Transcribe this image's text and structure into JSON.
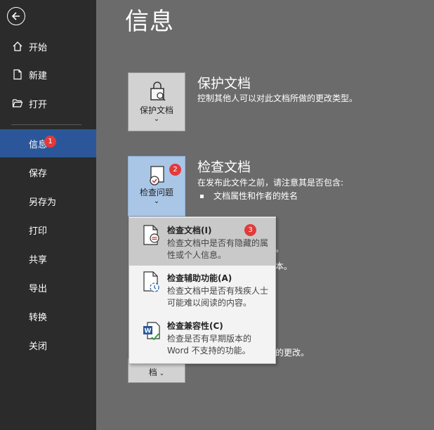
{
  "sidebar": {
    "back_icon": "arrow-left-icon",
    "items": [
      {
        "label": "开始",
        "icon": "home-icon"
      },
      {
        "label": "新建",
        "icon": "new-document-icon"
      },
      {
        "label": "打开",
        "icon": "folder-open-icon"
      },
      {
        "label": "信息",
        "badge": "1"
      },
      {
        "label": "保存"
      },
      {
        "label": "另存为"
      },
      {
        "label": "打印"
      },
      {
        "label": "共享"
      },
      {
        "label": "导出"
      },
      {
        "label": "转换"
      },
      {
        "label": "关闭"
      }
    ]
  },
  "page_title": "信息",
  "protect": {
    "tile_label": "保护文档",
    "title": "保护文档",
    "desc": "控制其他人可以对此文档所做的更改类型。"
  },
  "inspect": {
    "tile_label": "检查问题",
    "badge": "2",
    "title": "检查文档",
    "desc": "在发布此文件之前，请注意其是否包含:",
    "bullet": "文档属性和作者的姓名",
    "partial_1": "。",
    "partial_2": "本。",
    "partial_3": "的更改。",
    "bottom_tile_label": "档"
  },
  "dropdown": {
    "badge": "3",
    "items": [
      {
        "title": "检查文档(I)",
        "desc": "检查文档中是否有隐藏的属性或个人信息。"
      },
      {
        "title": "检查辅助功能(A)",
        "desc": "检查文档中是否有残疾人士可能难以阅读的内容。"
      },
      {
        "title": "检查兼容性(C)",
        "desc": "检查是否有早期版本的 Word 不支持的功能。"
      }
    ]
  },
  "colors": {
    "sidebar_bg": "#2b2b2b",
    "active_item": "#2b579a",
    "main_bg": "#6b6b6b",
    "badge": "#e23a3a"
  }
}
